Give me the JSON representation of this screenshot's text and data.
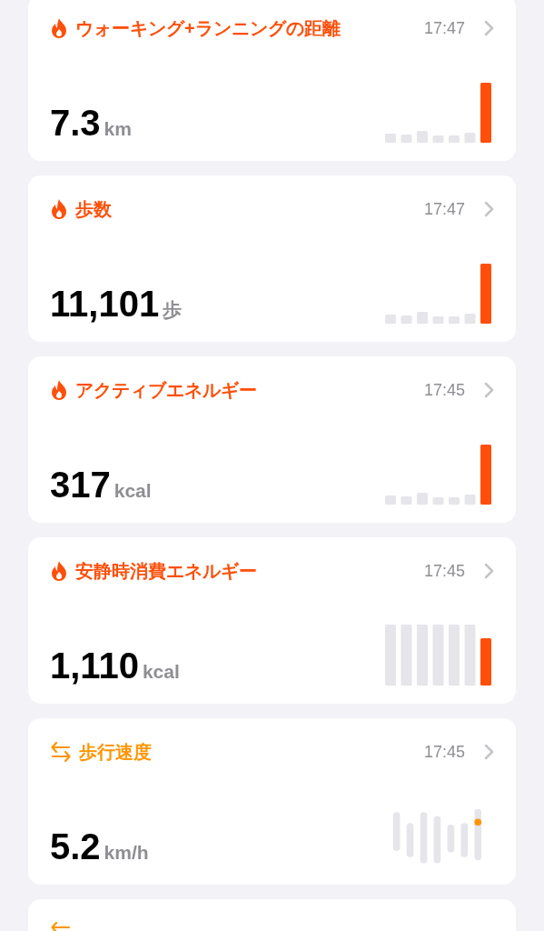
{
  "cards": [
    {
      "kind": "bars",
      "title": "ウォーキング+ランニングの距離",
      "time": "17:47",
      "value": "7.3",
      "unit": "km",
      "color": "#ff4f0a"
    },
    {
      "kind": "bars",
      "title": "歩数",
      "time": "17:47",
      "value": "11,101",
      "unit": "歩",
      "color": "#ff4f0a"
    },
    {
      "kind": "bars",
      "title": "アクティブエネルギー",
      "time": "17:45",
      "value": "317",
      "unit": "kcal",
      "color": "#ff4f0a"
    },
    {
      "kind": "tall-bars",
      "title": "安静時消費エネルギー",
      "time": "17:45",
      "value": "1,110",
      "unit": "kcal",
      "color": "#ff4f0a"
    },
    {
      "kind": "range",
      "title": "歩行速度",
      "time": "17:45",
      "value": "5.2",
      "unit": "km/h",
      "color": "#ff9500"
    },
    {
      "kind": "range",
      "color": "#ff9500"
    }
  ]
}
